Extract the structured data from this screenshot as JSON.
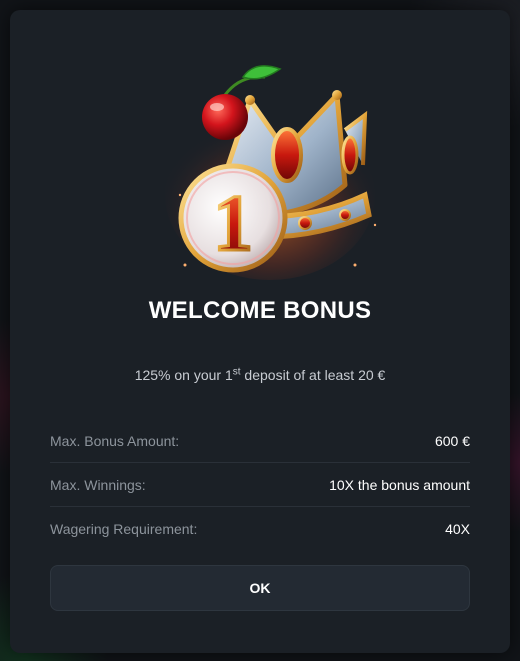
{
  "modal": {
    "title": "WELCOME BONUS",
    "subtitle": {
      "prefix": "125% on your 1",
      "superscript": "st",
      "suffix": " deposit of at least 20 €"
    },
    "details": [
      {
        "label": "Max. Bonus Amount:",
        "value": "600 €"
      },
      {
        "label": "Max. Winnings:",
        "value": "10X the bonus amount"
      },
      {
        "label": "Wagering Requirement:",
        "value": "40X"
      }
    ],
    "ok_label": "OK",
    "hero_badge_text": "1"
  },
  "colors": {
    "modal_bg": "#1b2026",
    "button_bg": "#232a33",
    "label": "#8d949c",
    "value": "#ffffff"
  }
}
